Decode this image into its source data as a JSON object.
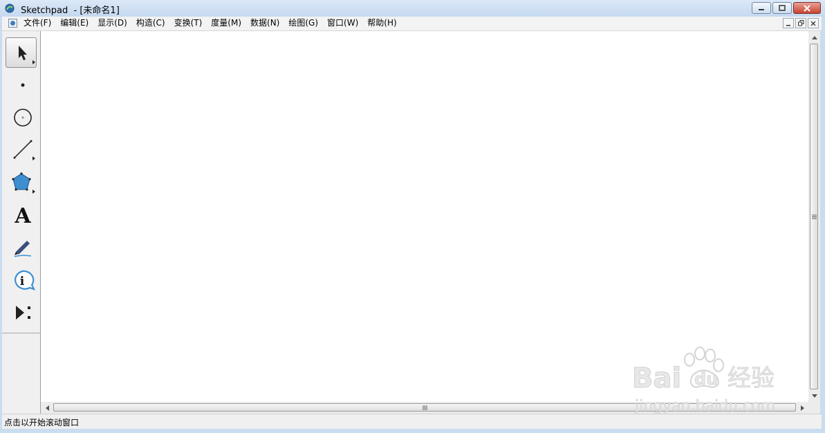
{
  "window": {
    "title": "Sketchpad  - [未命名1]",
    "buttons": [
      "minimize",
      "maximize",
      "close"
    ]
  },
  "menubar": {
    "items": [
      "文件(F)",
      "编辑(E)",
      "显示(D)",
      "构造(C)",
      "变换(T)",
      "度量(M)",
      "数据(N)",
      "绘图(G)",
      "窗口(W)",
      "帮助(H)"
    ]
  },
  "toolbox": {
    "tools": [
      {
        "name": "selection-arrow-tool",
        "icon": "arrow-icon",
        "selected": true
      },
      {
        "name": "point-tool",
        "icon": "point-icon"
      },
      {
        "name": "compass-tool",
        "icon": "circle-icon"
      },
      {
        "name": "straightedge-tool",
        "icon": "segment-icon"
      },
      {
        "name": "polygon-tool",
        "icon": "pentagon-icon"
      },
      {
        "name": "text-tool",
        "icon": "letter-a-icon",
        "glyph": "A"
      },
      {
        "name": "marker-tool",
        "icon": "marker-pen-icon"
      },
      {
        "name": "information-tool",
        "icon": "info-icon",
        "glyph": "i"
      },
      {
        "name": "custom-tool",
        "icon": "play-menu-icon"
      }
    ]
  },
  "status": {
    "text": "点击以开始滚动窗口"
  },
  "watermark": {
    "brand_text": "Bai",
    "brand_du": "du",
    "brand_cn": "经验",
    "url": "jingyan.baidu.com"
  },
  "colors": {
    "titlebar": "#c9dcf0",
    "canvas": "#ffffff",
    "polygon_fill": "#3d8fd0",
    "close_button": "#c8432f"
  }
}
